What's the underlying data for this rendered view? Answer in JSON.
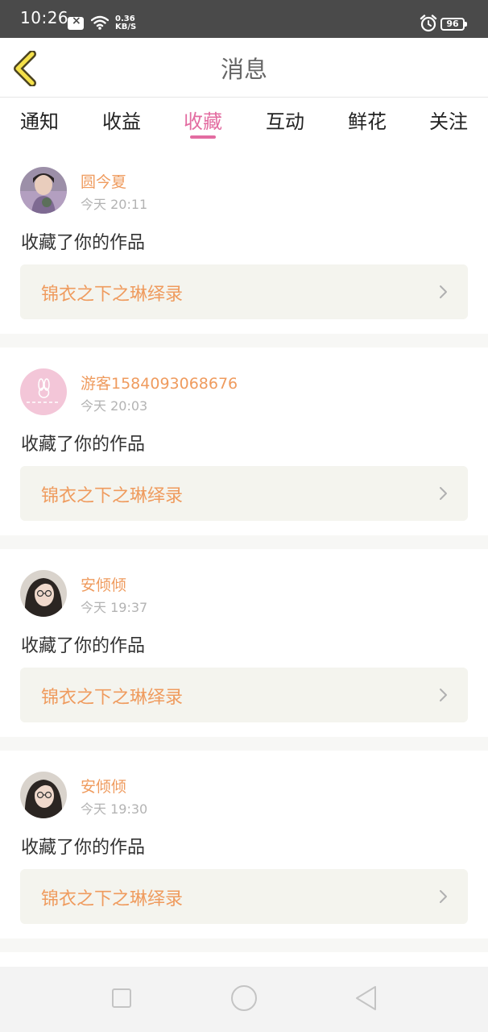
{
  "status_bar": {
    "time": "10:26",
    "net_speed_value": "0.36",
    "net_speed_unit": "KB/S",
    "battery": "96"
  },
  "header": {
    "title": "消息",
    "back_icon": "chevron-left-icon"
  },
  "tabs": [
    {
      "label": "通知",
      "active": false
    },
    {
      "label": "收益",
      "active": false
    },
    {
      "label": "收藏",
      "active": true
    },
    {
      "label": "互动",
      "active": false
    },
    {
      "label": "鲜花",
      "active": false
    },
    {
      "label": "关注",
      "active": false
    }
  ],
  "messages": [
    {
      "username": "圆今夏",
      "time": "今天 20:11",
      "action": "收藏了你的作品",
      "work_title": "锦衣之下之琳绎录"
    },
    {
      "username": "游客1584093068676",
      "time": "今天 20:03",
      "action": "收藏了你的作品",
      "work_title": "锦衣之下之琳绎录"
    },
    {
      "username": "安倾倾",
      "time": "今天 19:37",
      "action": "收藏了你的作品",
      "work_title": "锦衣之下之琳绎录"
    },
    {
      "username": "安倾倾",
      "time": "今天 19:30",
      "action": "收藏了你的作品",
      "work_title": "锦衣之下之琳绎录"
    }
  ],
  "colors": {
    "accent_pink": "#e36ca1",
    "name_orange": "#ef9b5e",
    "status_bar_bg": "#4a4a4a",
    "card_box_bg": "#f4f4ee",
    "back_icon_fill": "#f5e14a"
  },
  "nav": {
    "recents_icon": "square-icon",
    "home_icon": "circle-icon",
    "back_icon": "triangle-back-icon"
  }
}
